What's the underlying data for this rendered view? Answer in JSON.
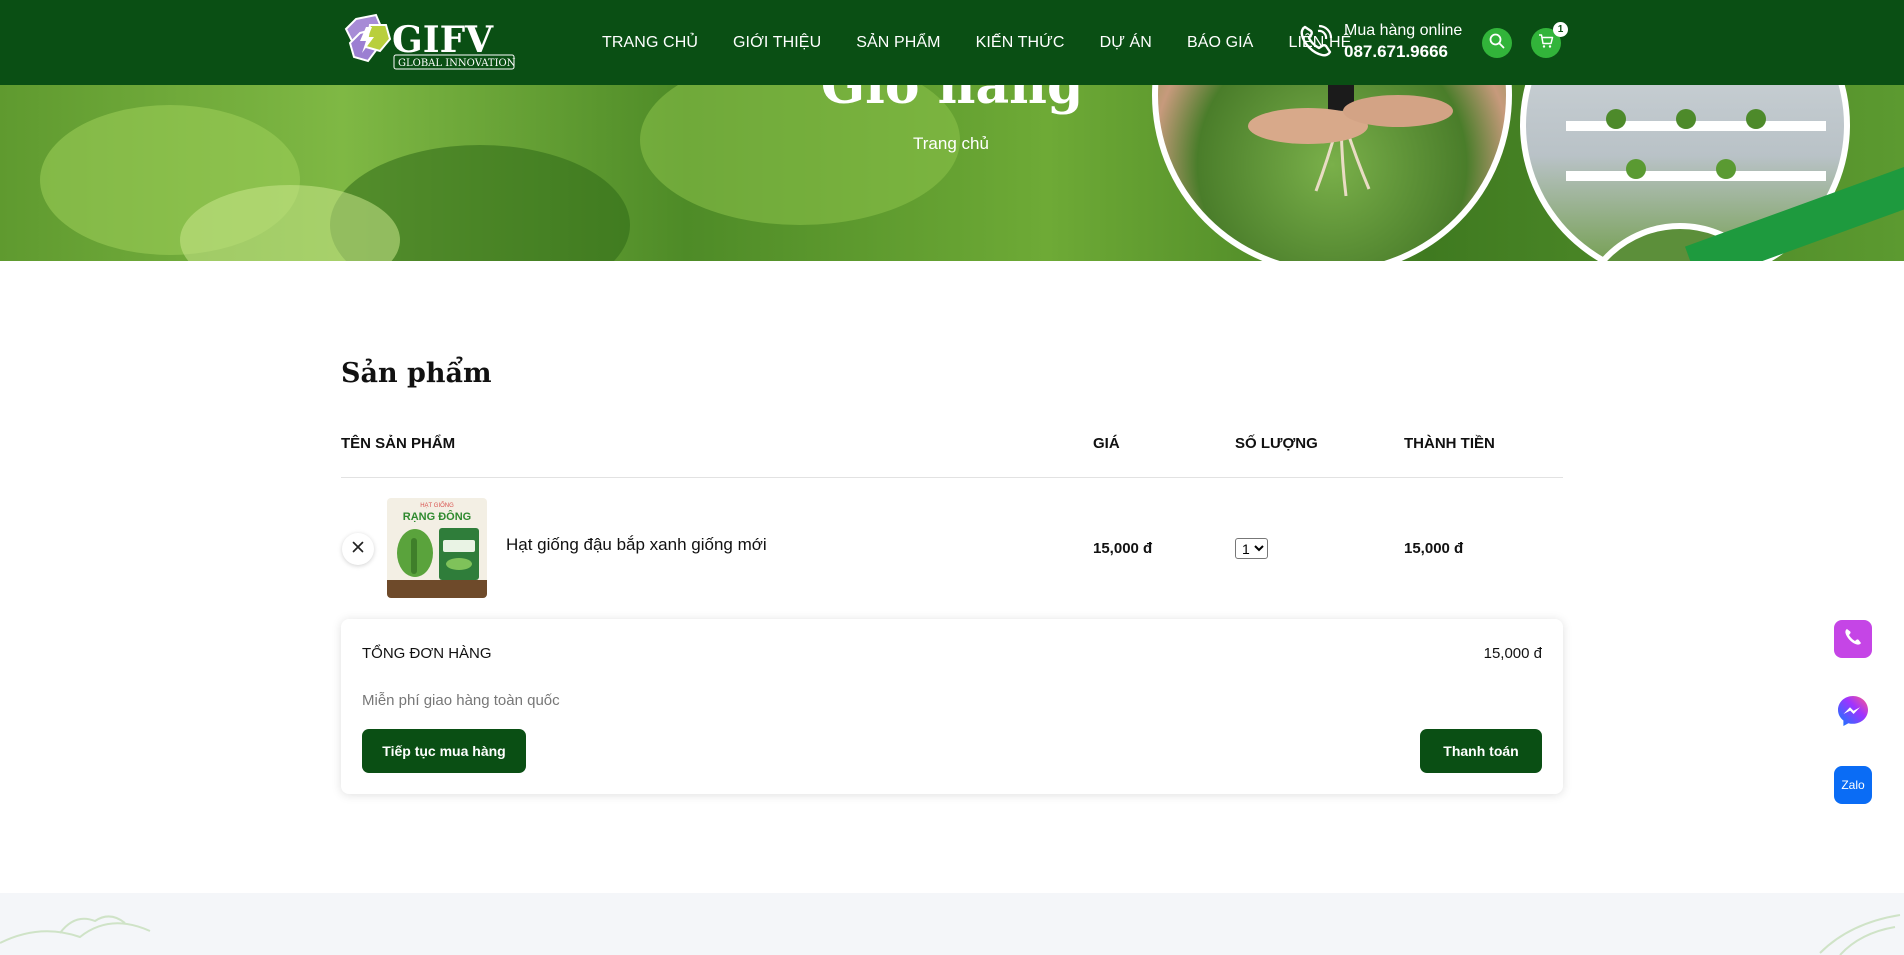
{
  "brand": {
    "logo_text": "GIFV",
    "logo_tagline": "GLOBAL INNOVATION",
    "primary_color": "#0a4f14",
    "accent_color": "#32b43a"
  },
  "nav": {
    "items": [
      {
        "label": "TRANG CHỦ"
      },
      {
        "label": "GIỚI THIỆU"
      },
      {
        "label": "SẢN PHẨM"
      },
      {
        "label": "KIẾN THỨC"
      },
      {
        "label": "DỰ ÁN"
      },
      {
        "label": "BÁO GIÁ"
      },
      {
        "label": "LIÊN HỆ"
      }
    ]
  },
  "hotline": {
    "label": "Mua hàng online",
    "number": "087.671.9666",
    "icon": "phone-icon"
  },
  "header_actions": {
    "search_icon": "search-icon",
    "cart_icon": "cart-icon",
    "cart_count": "1"
  },
  "banner": {
    "title": "Giỏ hàng",
    "breadcrumb": "Trang chủ"
  },
  "cart": {
    "section_title": "Sản phẩm",
    "columns": [
      "TÊN SẢN PHẨM",
      "GIÁ",
      "SỐ LƯỢNG",
      "THÀNH TIỀN"
    ],
    "items": [
      {
        "name": "Hạt giống đậu bắp xanh giống mới",
        "thumb_brand": "RẠNG ĐÔNG",
        "thumb_top": "HẠT GIỐNG",
        "price": "15,000 đ",
        "quantity": "1",
        "subtotal": "15,000 đ"
      }
    ]
  },
  "summary": {
    "label": "TỔNG ĐƠN HÀNG",
    "total": "15,000 đ",
    "note": "Miễn phí giao hàng toàn quốc",
    "continue_label": "Tiếp tục mua hàng",
    "checkout_label": "Thanh toán"
  },
  "floating": {
    "phone_icon": "phone-icon",
    "messenger_icon": "messenger-icon",
    "zalo_label": "Zalo"
  }
}
